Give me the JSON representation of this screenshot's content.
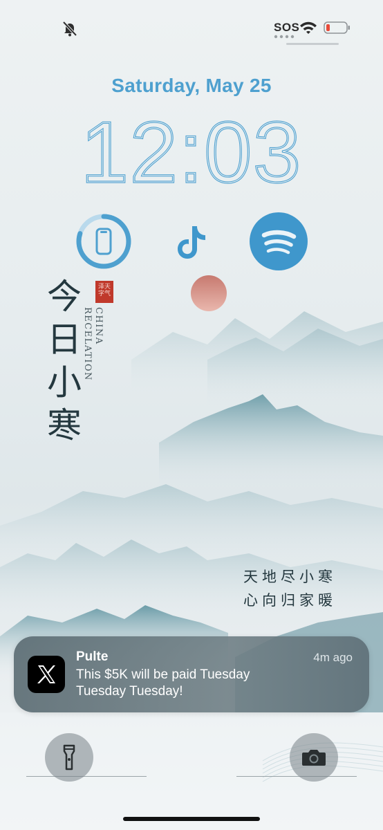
{
  "status_bar": {
    "sos_label": "SOS",
    "icons": [
      "bell-slash-icon",
      "wifi-icon",
      "battery-low-icon"
    ],
    "battery_color": "#e84b3a"
  },
  "lock_screen": {
    "date": "Saturday, May 25",
    "time": "12:03",
    "accent_color": "#4ea0cf"
  },
  "widgets": [
    {
      "name": "phone-battery-widget",
      "icon": "phone-icon",
      "progress_percent": 80
    },
    {
      "name": "tiktok-widget",
      "icon": "tiktok-icon"
    },
    {
      "name": "spotify-widget",
      "icon": "spotify-icon"
    }
  ],
  "wallpaper": {
    "vertical_title": [
      "今",
      "日",
      "小",
      "寒"
    ],
    "seal_text": "泽天字气",
    "english_lines": [
      "CHINA",
      "RECELATION"
    ],
    "poem_lines": [
      "天地尽小寒",
      "心向归家暖"
    ]
  },
  "notification": {
    "app_name": "Pulte",
    "time": "4m ago",
    "message": "This $5K will be paid Tuesday Tuesday Tuesday!",
    "icon": "x-logo-icon"
  },
  "quick_actions": {
    "left": "flashlight-icon",
    "right": "camera-icon"
  }
}
